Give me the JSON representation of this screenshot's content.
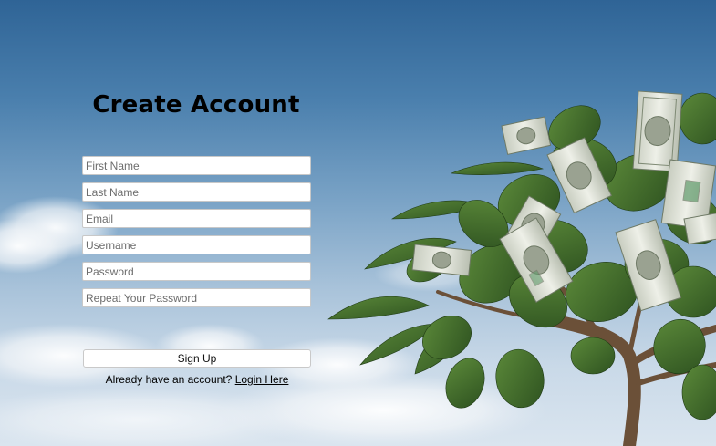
{
  "form": {
    "title": "Create Account",
    "fields": {
      "first_name_placeholder": "First Name",
      "last_name_placeholder": "Last Name",
      "email_placeholder": "Email",
      "username_placeholder": "Username",
      "password_placeholder": "Password",
      "repeat_password_placeholder": "Repeat Your Password"
    },
    "signup_label": "Sign Up",
    "login_prompt": "Already have an account?",
    "login_link": "Login Here"
  },
  "background": {
    "sky_color": "#4a7fad",
    "leaf_color": "#3f6b2a",
    "banknote_color": "#d9ddd2"
  }
}
